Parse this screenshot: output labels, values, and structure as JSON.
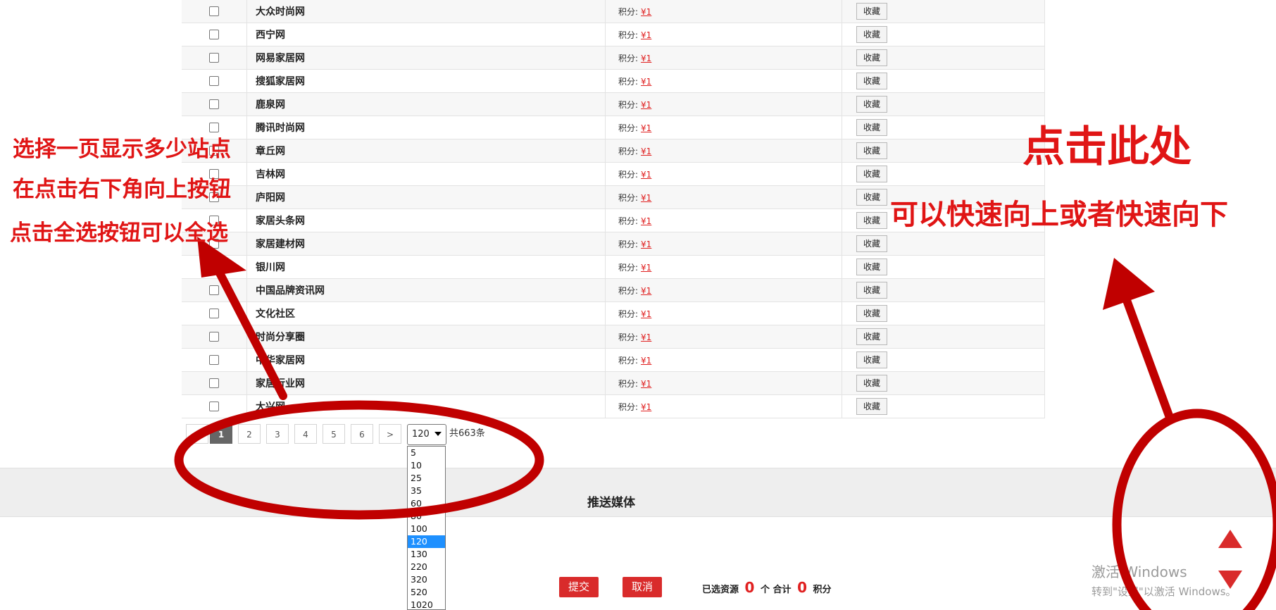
{
  "rows": [
    {
      "name": "大众时尚网",
      "points_label": "积分:",
      "price": "¥1",
      "action": "收藏"
    },
    {
      "name": "西宁网",
      "points_label": "积分:",
      "price": "¥1",
      "action": "收藏"
    },
    {
      "name": "网易家居网",
      "points_label": "积分:",
      "price": "¥1",
      "action": "收藏"
    },
    {
      "name": "搜狐家居网",
      "points_label": "积分:",
      "price": "¥1",
      "action": "收藏"
    },
    {
      "name": "鹿泉网",
      "points_label": "积分:",
      "price": "¥1",
      "action": "收藏"
    },
    {
      "name": "腾讯时尚网",
      "points_label": "积分:",
      "price": "¥1",
      "action": "收藏"
    },
    {
      "name": "章丘网",
      "points_label": "积分:",
      "price": "¥1",
      "action": "收藏"
    },
    {
      "name": "吉林网",
      "points_label": "积分:",
      "price": "¥1",
      "action": "收藏"
    },
    {
      "name": "庐阳网",
      "points_label": "积分:",
      "price": "¥1",
      "action": "收藏"
    },
    {
      "name": "家居头条网",
      "points_label": "积分:",
      "price": "¥1",
      "action": "收藏"
    },
    {
      "name": "家居建材网",
      "points_label": "积分:",
      "price": "¥1",
      "action": "收藏"
    },
    {
      "name": "银川网",
      "points_label": "积分:",
      "price": "¥1",
      "action": "收藏"
    },
    {
      "name": "中国品牌资讯网",
      "points_label": "积分:",
      "price": "¥1",
      "action": "收藏"
    },
    {
      "name": "文化社区",
      "points_label": "积分:",
      "price": "¥1",
      "action": "收藏"
    },
    {
      "name": "时尚分享圈",
      "points_label": "积分:",
      "price": "¥1",
      "action": "收藏"
    },
    {
      "name": "中华家居网",
      "points_label": "积分:",
      "price": "¥1",
      "action": "收藏"
    },
    {
      "name": "家居行业网",
      "points_label": "积分:",
      "price": "¥1",
      "action": "收藏"
    },
    {
      "name": "大兴网",
      "points_label": "积分:",
      "price": "¥1",
      "action": "收藏"
    }
  ],
  "pagination": {
    "pages": [
      "1",
      "2",
      "3",
      "4",
      "5",
      "6"
    ],
    "active_page": "1",
    "next": ">",
    "per_page": "120",
    "total_text": "共663条",
    "per_page_options": [
      "5",
      "10",
      "25",
      "35",
      "60",
      "80",
      "100",
      "120",
      "130",
      "220",
      "320",
      "520",
      "1020"
    ]
  },
  "section": {
    "title": "推送媒体"
  },
  "actions": {
    "submit": "提交",
    "cancel": "取消"
  },
  "summary": {
    "selected_label": "已选资源",
    "selected_count": "0",
    "unit": "个",
    "total_label": "合计",
    "total_points": "0",
    "points_label": "积分"
  },
  "annotations": {
    "left": [
      "选择一页显示多少站点",
      "在点击右下角向上按钮",
      "点击全选按钮可以全选"
    ],
    "right_title": "点击此处",
    "right_sub": "可以快速向上或者快速向下"
  },
  "watermark": {
    "line1": "激活 Windows",
    "line2": "转到\"设置\"以激活 Windows。"
  },
  "colors": {
    "accent_red": "#d92b2b",
    "annotation_red": "#e01515",
    "selected_option": "#1e90ff"
  }
}
